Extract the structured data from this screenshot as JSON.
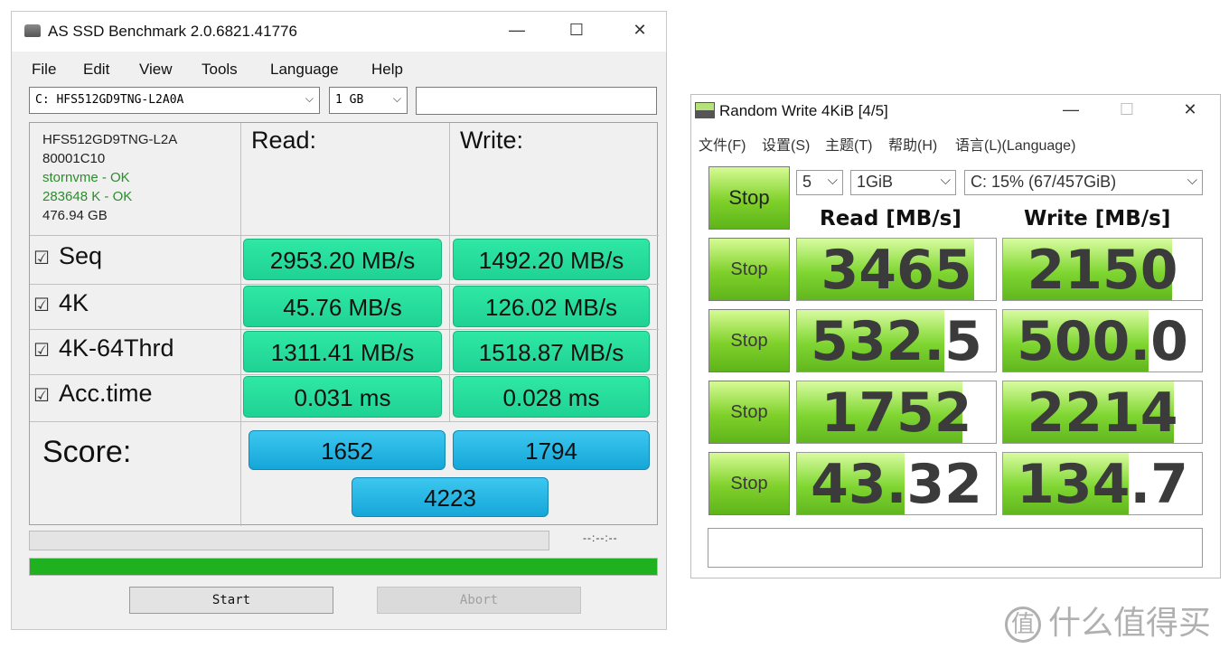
{
  "asssd": {
    "title": "AS SSD Benchmark 2.0.6821.41776",
    "menu": [
      "File",
      "Edit",
      "View",
      "Tools",
      "Language",
      "Help"
    ],
    "drive_select": "C:  HFS512GD9TNG-L2A0A",
    "size_select": "1 GB",
    "drive_info": {
      "model": "HFS512GD9TNG-L2A",
      "firmware": "80001C10",
      "driver": "stornvme",
      "driver_status": " - OK",
      "alignment": "283648 K",
      "alignment_status": " - OK",
      "capacity": "476.94 GB"
    },
    "headers": {
      "read": "Read:",
      "write": "Write:"
    },
    "rows": [
      {
        "label": "Seq",
        "read": "2953.20 MB/s",
        "write": "1492.20 MB/s"
      },
      {
        "label": "4K",
        "read": "45.76 MB/s",
        "write": "126.02 MB/s"
      },
      {
        "label": "4K-64Thrd",
        "read": "1311.41 MB/s",
        "write": "1518.87 MB/s"
      },
      {
        "label": "Acc.time",
        "read": "0.031 ms",
        "write": "0.028 ms"
      }
    ],
    "checkbox_glyph": "☑",
    "score_label": "Score:",
    "score_read": "1652",
    "score_write": "1794",
    "score_total": "4223",
    "time_readout": "--:--:--",
    "progress_fraction": 1.0,
    "start_label": "Start",
    "abort_label": "Abort",
    "colors": {
      "result_green": "#23dc9c",
      "score_blue": "#22b0e2",
      "progress_green": "#1fb11f"
    }
  },
  "cdm": {
    "title": "Random Write 4KiB [4/5]",
    "menu": [
      "文件(F)",
      "设置(S)",
      "主题(T)",
      "帮助(H)",
      "语言(L)(Language)"
    ],
    "count_select": "5",
    "size_select": "1GiB",
    "drive_select": "C: 15% (67/457GiB)",
    "main_stop_label": "Stop",
    "read_header": "Read [MB/s]",
    "write_header": "Write [MB/s]",
    "rows": [
      {
        "stop_label": "Stop",
        "read": "3465",
        "write": "2150",
        "read_fill": 0.89,
        "write_fill": 0.85
      },
      {
        "stop_label": "Stop",
        "read": "532.5",
        "write": "500.0",
        "read_fill": 0.74,
        "write_fill": 0.73
      },
      {
        "stop_label": "Stop",
        "read": "1752",
        "write": "2214",
        "read_fill": 0.83,
        "write_fill": 0.86
      },
      {
        "stop_label": "Stop",
        "read": "43.32",
        "write": "134.7",
        "read_fill": 0.54,
        "write_fill": 0.63
      }
    ],
    "colors": {
      "bar_green": "#7fd631"
    }
  },
  "watermark": {
    "text": "什么值得买",
    "logo": "值"
  }
}
